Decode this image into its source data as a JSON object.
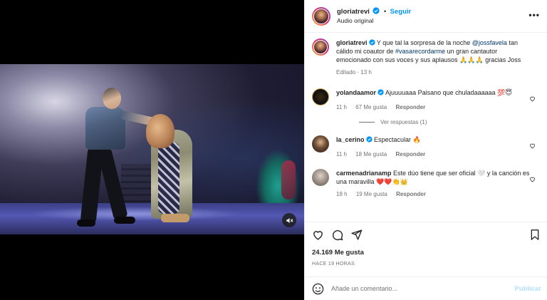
{
  "post": {
    "username": "gloriatrevi",
    "follow_label": "Seguir",
    "audio_label": "Audio original",
    "more_icon": "more-horizontal-icon"
  },
  "caption": {
    "username": "gloriatrevi",
    "text_1": " Y que tal la sorpresa de la noche ",
    "mention_1": "@jossfavela",
    "text_2": " tan cálido mi coautor de ",
    "hashtag": "#vasarecordarme",
    "text_3": " un gran cantautor emocionado con sus voces y sus aplausos 🙏🙏🙏 gracias Joss",
    "edited": "Editado · 13 h"
  },
  "comments": [
    {
      "username": "yolandaamor",
      "text": " Ajuuuuaaa Paisano que chuladaaaaaa 💯😇",
      "time": "11 h",
      "likes": "67 Me gusta",
      "reply": "Responder",
      "view_replies": "Ver respuestas (1)"
    },
    {
      "username": "la_cerino",
      "text": " Espectacular 🔥",
      "time": "11 h",
      "likes": "18 Me gusta",
      "reply": "Responder"
    },
    {
      "username": "carmenadrianamp",
      "text": " Este dúo tiene que ser oficial 🤍 y la canción es una maravilla ❤️❤️👏👑",
      "time": "18 h",
      "likes": "19 Me gusta",
      "reply": "Responder"
    }
  ],
  "stats": {
    "likes": "24.169 Me gusta",
    "time_ago": "HACE 19 HORAS"
  },
  "comment_box": {
    "placeholder": "Añade un comentario...",
    "publish_label": "Publicar"
  },
  "colors": {
    "accent": "#0095f6",
    "publish_disabled": "#b2dffc",
    "muted": "#737373",
    "link": "#00376b"
  }
}
